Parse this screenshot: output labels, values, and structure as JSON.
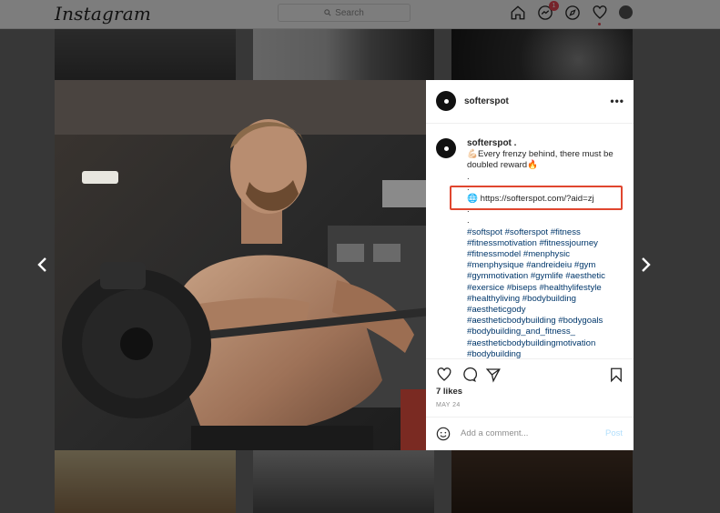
{
  "app": {
    "logo": "Instagram"
  },
  "topbar": {
    "search_placeholder": "Search",
    "messages_badge": "1"
  },
  "post": {
    "username": "softerspot",
    "caption_author": "softerspot .",
    "caption_lines": [
      "💪🏻Every frenzy behind, there must be",
      "doubled reward🔥",
      ".",
      ".",
      "🌐 https://softerspot.com/?aid=zj",
      ".",
      "."
    ],
    "hashtag_lines": [
      "#softspot #softerspot #fitness",
      "#fitnessmotivation #fitnessjourney",
      "#fitnessmodel #menphysic",
      "#menphysique #andreideiu #gym",
      "#gymmotivation #gymlife #aesthetic",
      "#exersice #biseps #healthylifestyle",
      "#healthyliving #bodybuilding",
      "#aestheticgody",
      "#aestheticbodybuilding #bodygoals",
      "#bodybuilding_and_fitness_",
      "#aestheticbodybuildingmotivation",
      "#bodybuilding"
    ],
    "likes": "7 likes",
    "date": "MAY 24",
    "comment_placeholder": "Add a comment...",
    "post_label": "Post",
    "more_label": "•••"
  },
  "colors": {
    "highlight_box": "#e0462f",
    "hashtag": "#00376b",
    "badge": "#ed4956"
  }
}
